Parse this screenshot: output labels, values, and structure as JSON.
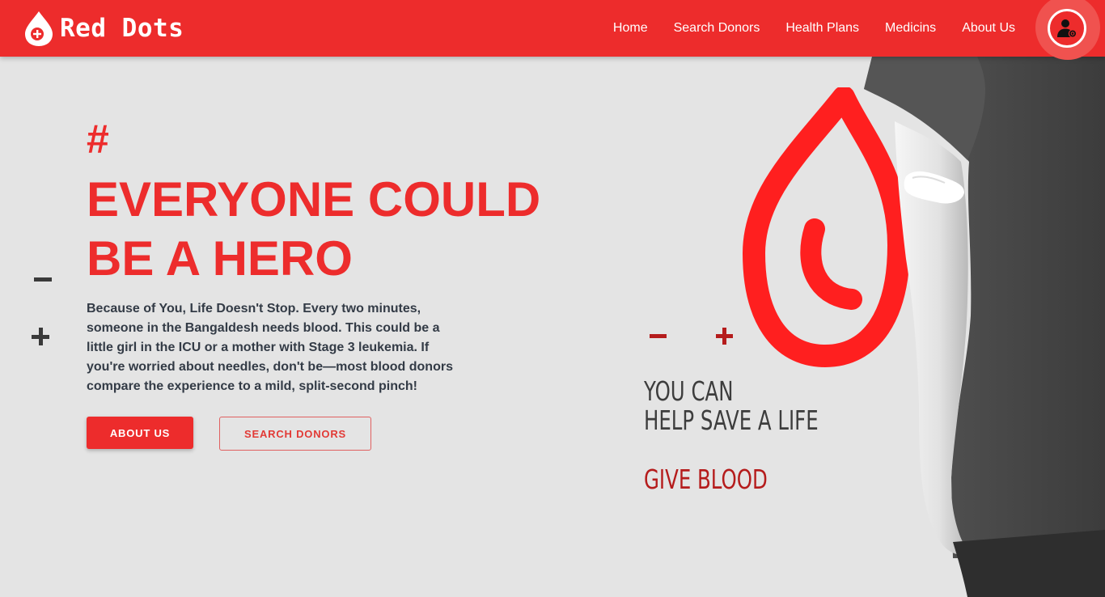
{
  "brand": {
    "name": "Red Dots",
    "icon": "blood-drop-plus-icon"
  },
  "nav": {
    "items": [
      {
        "label": "Home"
      },
      {
        "label": "Search Donors"
      },
      {
        "label": "Health Plans"
      },
      {
        "label": "Medicins"
      },
      {
        "label": "About Us"
      }
    ],
    "account_icon": "user-account-icon"
  },
  "hero": {
    "hash": "#",
    "title_line1": "EVERYONE COULD",
    "title_line2": "BE A HERO",
    "description": "Because of You, Life Doesn't Stop. Every two minutes, someone in the Bangaldesh needs blood. This could be a little girl in the ICU or a mother with Stage 3 leukemia. If you're worried about needles, don't be—most blood donors compare the experience to a mild, split-second pinch!",
    "about_button": "ABOUT US",
    "search_button": "SEARCH DONORS"
  },
  "promo": {
    "line1": "YOU CAN",
    "line2": "HELP SAVE A LIFE",
    "cta": "GIVE BLOOD"
  },
  "colors": {
    "primary": "#ed2c2c",
    "dark_red": "#b51c1c",
    "background": "#e4e4e4",
    "text": "#333b46"
  }
}
